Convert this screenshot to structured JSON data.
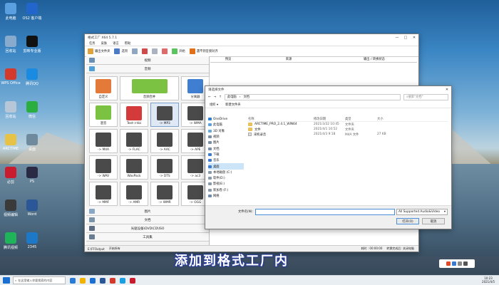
{
  "desktop": {
    "icons": [
      {
        "label": "此电脑",
        "color": "#5aa0e0",
        "name": "this-pc"
      },
      {
        "label": "OS2 客户端",
        "color": "#2266cc",
        "name": "os2-client"
      },
      {
        "label": "回收站",
        "color": "#88aacc",
        "name": "recycle-bin"
      },
      {
        "label": "剪映专业版",
        "color": "#111111",
        "name": "jianying"
      },
      {
        "label": "WPS Office",
        "color": "#d33a2c",
        "name": "wps-office"
      },
      {
        "label": "腾讯QQ",
        "color": "#1a8be0",
        "name": "tencent-qq"
      },
      {
        "label": "回收站",
        "color": "#b7c7d7",
        "name": "recycle-bin-2"
      },
      {
        "label": "微信",
        "color": "#2aae3f",
        "name": "wechat"
      },
      {
        "label": "ARCTIME",
        "color": "#e6c246",
        "name": "arctime"
      },
      {
        "label": "桌面",
        "color": "#6f8a9c",
        "name": "desktop-folder"
      },
      {
        "label": "必剪",
        "color": "#c91c2e",
        "name": "bijian"
      },
      {
        "label": "PS",
        "color": "#2a2a44",
        "name": "photoshop"
      },
      {
        "label": "视频编辑",
        "color": "#3a3a3a",
        "name": "video-editor"
      },
      {
        "label": "Word",
        "color": "#2b5797",
        "name": "word"
      },
      {
        "label": "腾讯视频",
        "color": "#1fb45a",
        "name": "tencent-video"
      },
      {
        "label": "2345",
        "color": "#1e78c8",
        "name": "browser-2345"
      }
    ]
  },
  "app": {
    "title": "格式工厂 X64 5.7.1",
    "window_controls": [
      "—",
      "□",
      "✕"
    ],
    "menu": [
      "任务",
      "皮肤",
      "语言",
      "帮助"
    ],
    "toolbar": [
      {
        "label": "输出文件夹",
        "color": "#e0a23a",
        "name": "output-folder"
      },
      {
        "label": "选项",
        "color": "#4a7bc4",
        "name": "options"
      },
      {
        "label": "",
        "color": "#8fa7c2",
        "name": "tool-3"
      },
      {
        "label": "",
        "color": "#d04a4a",
        "name": "delete"
      },
      {
        "label": "",
        "color": "#aab4c0",
        "name": "tool-5"
      },
      {
        "label": "",
        "color": "#e06a6a",
        "name": "stop"
      },
      {
        "label": "开始",
        "color": "#5cc45c",
        "name": "start"
      },
      {
        "label": "遇不到音频对齐",
        "color": "#e0701a",
        "name": "promo"
      }
    ],
    "categories_top": [
      "视频",
      "音频"
    ],
    "tiles": [
      {
        "label": "自定义",
        "color": "#e37a3a",
        "name": "custom",
        "big": false
      },
      {
        "label": "音频合并",
        "color": "#7bc142",
        "name": "audio-merge",
        "big": true
      },
      {
        "label": "分离器",
        "color": "#3f7ed1",
        "name": "splitter",
        "big": false
      },
      {
        "label": "混音",
        "color": "#7bc142",
        "name": "mixer",
        "big": false
      },
      {
        "label": "Text->Voi",
        "color": "#d43a3a",
        "name": "text-voice",
        "big": false
      },
      {
        "label": "-> MP3",
        "color": "#4a4a4a",
        "name": "to-mp3",
        "big": false,
        "selected": true
      },
      {
        "label": "-> WMA",
        "color": "#4a4a4a",
        "name": "to-wma",
        "big": false
      },
      {
        "label": "-> M4A",
        "color": "#4a4a4a",
        "name": "to-m4a",
        "big": false
      },
      {
        "label": "-> FLAC",
        "color": "#4a4a4a",
        "name": "to-flac",
        "big": false
      },
      {
        "label": "-> AAC",
        "color": "#4a4a4a",
        "name": "to-aac",
        "big": false
      },
      {
        "label": "-> APE",
        "color": "#4a4a4a",
        "name": "to-ape",
        "big": false
      },
      {
        "label": "-> WAV",
        "color": "#4a4a4a",
        "name": "to-wav",
        "big": false
      },
      {
        "label": "WavPack",
        "color": "#4a4a4a",
        "name": "to-wavpack",
        "big": false
      },
      {
        "label": "-> DTS",
        "color": "#4a4a4a",
        "name": "to-dts",
        "big": false
      },
      {
        "label": "-> ac3",
        "color": "#4a4a4a",
        "name": "to-ac3",
        "big": false
      },
      {
        "label": "-> MMF",
        "color": "#4a4a4a",
        "name": "to-mmf",
        "big": false
      },
      {
        "label": "-> AMR",
        "color": "#4a4a4a",
        "name": "to-amr",
        "big": false
      },
      {
        "label": "-> WMR",
        "color": "#4a4a4a",
        "name": "to-wmr",
        "big": false
      },
      {
        "label": "-> OGG",
        "color": "#4a4a4a",
        "name": "to-ogg",
        "big": false
      }
    ],
    "categories_bottom": [
      "图片",
      "文档",
      "光驱设备\\DVD\\CD\\ISO",
      "工具集"
    ],
    "columns": [
      "预览",
      "来源",
      "输出 / 转换状态"
    ],
    "status": [
      "E:\\FFOutput",
      "开始所有"
    ],
    "status_right": [
      "耗时 : 00:00:00",
      "转换完成后: 关闭电脑"
    ]
  },
  "dialog": {
    "title": "请选择文件",
    "path": [
      "此电脑",
      "文档"
    ],
    "search_placeholder": "搜索\"文档\"",
    "toolbar": [
      "组织 ▾",
      "新建文件夹"
    ],
    "tree": [
      {
        "label": "OneDrive",
        "color": "#2d7fd6"
      },
      {
        "label": "此电脑",
        "color": "#5aa0e0"
      },
      {
        "label": "3D 对象",
        "color": "#6aa8d8"
      },
      {
        "label": "视频",
        "color": "#7a8ea6"
      },
      {
        "label": "图片",
        "color": "#7a8ea6"
      },
      {
        "label": "文档",
        "color": "#7a8ea6"
      },
      {
        "label": "下载",
        "color": "#3a7ad0"
      },
      {
        "label": "音乐",
        "color": "#3a7ad0"
      },
      {
        "label": "桌面",
        "color": "#3a7ad0",
        "selected": true
      },
      {
        "label": "本地磁盘 (C:)",
        "color": "#8899aa"
      },
      {
        "label": "软件(D:)",
        "color": "#8899aa"
      },
      {
        "label": "影视(E:)",
        "color": "#8899aa"
      },
      {
        "label": "新加卷 (F:)",
        "color": "#8899aa"
      },
      {
        "label": "网络",
        "color": "#6a8cb0"
      }
    ],
    "file_columns": [
      "名称",
      "修改日期",
      "类型",
      "大小"
    ],
    "files": [
      {
        "name": "ARCTIME_PRO_2.4.1_WIN64",
        "date": "2021/3/22 10:45",
        "type": "文件夹",
        "size": "",
        "kind": "folder"
      },
      {
        "name": "文件",
        "date": "2021/4/1 10:52",
        "type": "文件夹",
        "size": "",
        "kind": "folder"
      },
      {
        "name": "采机录音",
        "date": "2021/4/3 9:18",
        "type": "M4A 文件",
        "size": "27 KB",
        "kind": "file"
      }
    ],
    "filename_label": "文件名(N):",
    "filter": "All Supported Audio&Video",
    "open": "打开(O)",
    "cancel": "取消"
  },
  "subtitle": "添加到格式工厂内",
  "taskbar": {
    "search_placeholder": "在这里输入你要搜索的内容",
    "apps": [
      "#2a7bd4",
      "#f0b400",
      "#1a6fd0",
      "#2b5797",
      "#d33a2c",
      "#1aa0e0",
      "#c91c2e"
    ],
    "time": "10:23",
    "date": "2021/4/5"
  }
}
